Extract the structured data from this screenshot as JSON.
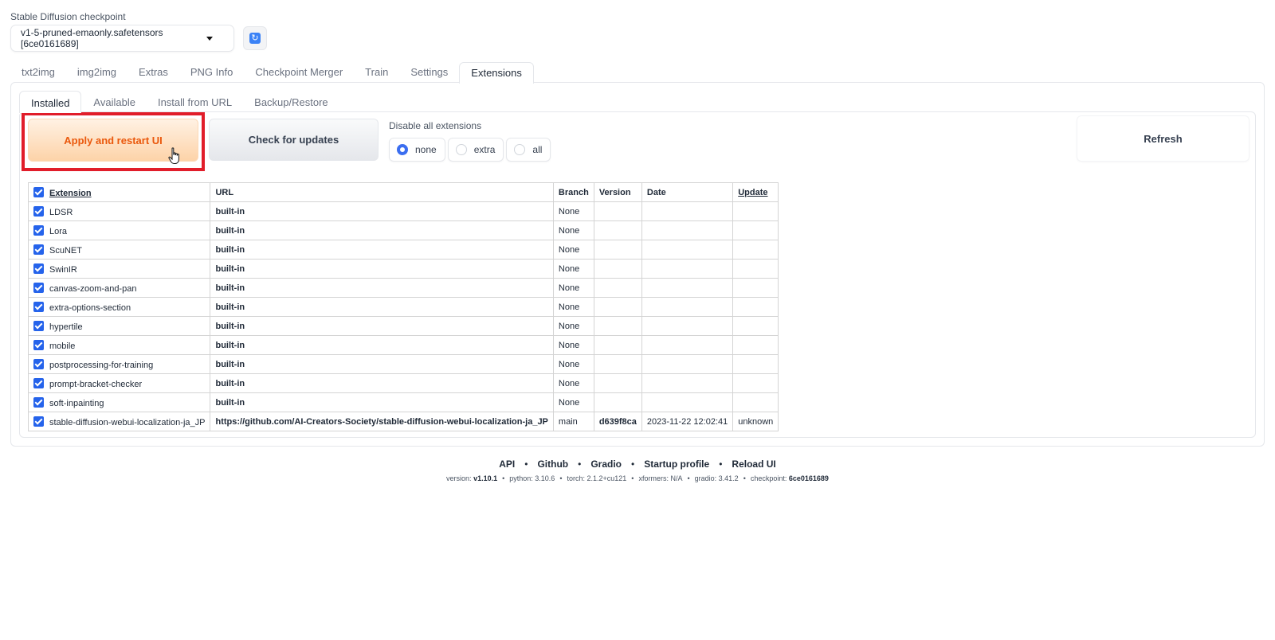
{
  "checkpoint": {
    "label": "Stable Diffusion checkpoint",
    "value": "v1-5-pruned-emaonly.safetensors [6ce0161689]",
    "refresh_icon": "refresh-icon"
  },
  "main_tabs": [
    "txt2img",
    "img2img",
    "Extras",
    "PNG Info",
    "Checkpoint Merger",
    "Train",
    "Settings",
    "Extensions"
  ],
  "main_tab_active": "Extensions",
  "sub_tabs": [
    "Installed",
    "Available",
    "Install from URL",
    "Backup/Restore"
  ],
  "sub_tab_active": "Installed",
  "buttons": {
    "apply": "Apply and restart UI",
    "check_updates": "Check for updates",
    "refresh": "Refresh"
  },
  "disable": {
    "label": "Disable all extensions",
    "options": [
      "none",
      "extra",
      "all"
    ],
    "selected": "none"
  },
  "table": {
    "headers": [
      "Extension",
      "URL",
      "Branch",
      "Version",
      "Date",
      "Update"
    ],
    "rows": [
      {
        "name": "LDSR",
        "url": "built-in",
        "branch": "None",
        "version": "",
        "date": "",
        "update": ""
      },
      {
        "name": "Lora",
        "url": "built-in",
        "branch": "None",
        "version": "",
        "date": "",
        "update": ""
      },
      {
        "name": "ScuNET",
        "url": "built-in",
        "branch": "None",
        "version": "",
        "date": "",
        "update": ""
      },
      {
        "name": "SwinIR",
        "url": "built-in",
        "branch": "None",
        "version": "",
        "date": "",
        "update": ""
      },
      {
        "name": "canvas-zoom-and-pan",
        "url": "built-in",
        "branch": "None",
        "version": "",
        "date": "",
        "update": ""
      },
      {
        "name": "extra-options-section",
        "url": "built-in",
        "branch": "None",
        "version": "",
        "date": "",
        "update": ""
      },
      {
        "name": "hypertile",
        "url": "built-in",
        "branch": "None",
        "version": "",
        "date": "",
        "update": ""
      },
      {
        "name": "mobile",
        "url": "built-in",
        "branch": "None",
        "version": "",
        "date": "",
        "update": ""
      },
      {
        "name": "postprocessing-for-training",
        "url": "built-in",
        "branch": "None",
        "version": "",
        "date": "",
        "update": ""
      },
      {
        "name": "prompt-bracket-checker",
        "url": "built-in",
        "branch": "None",
        "version": "",
        "date": "",
        "update": ""
      },
      {
        "name": "soft-inpainting",
        "url": "built-in",
        "branch": "None",
        "version": "",
        "date": "",
        "update": ""
      },
      {
        "name": "stable-diffusion-webui-localization-ja_JP",
        "url": "https://github.com/AI-Creators-Society/stable-diffusion-webui-localization-ja_JP",
        "branch": "main",
        "version": "d639f8ca",
        "date": "2023-11-22 12:02:41",
        "update": "unknown"
      }
    ]
  },
  "footer": {
    "links": [
      "API",
      "Github",
      "Gradio",
      "Startup profile",
      "Reload UI"
    ],
    "separator": "•",
    "versions": [
      {
        "label": "version: ",
        "value": "v1.10.1",
        "bold": true
      },
      {
        "label": "python: ",
        "value": "3.10.6",
        "bold": false
      },
      {
        "label": "torch: ",
        "value": "2.1.2+cu121",
        "bold": false
      },
      {
        "label": "xformers: ",
        "value": "N/A",
        "bold": false
      },
      {
        "label": "gradio: ",
        "value": "3.41.2",
        "bold": false
      },
      {
        "label": "checkpoint: ",
        "value": "6ce0161689",
        "bold": true
      }
    ]
  },
  "colors": {
    "accent_blue": "#2563eb",
    "apply_text": "#ea580c",
    "highlight_outline": "#e11d2a"
  }
}
